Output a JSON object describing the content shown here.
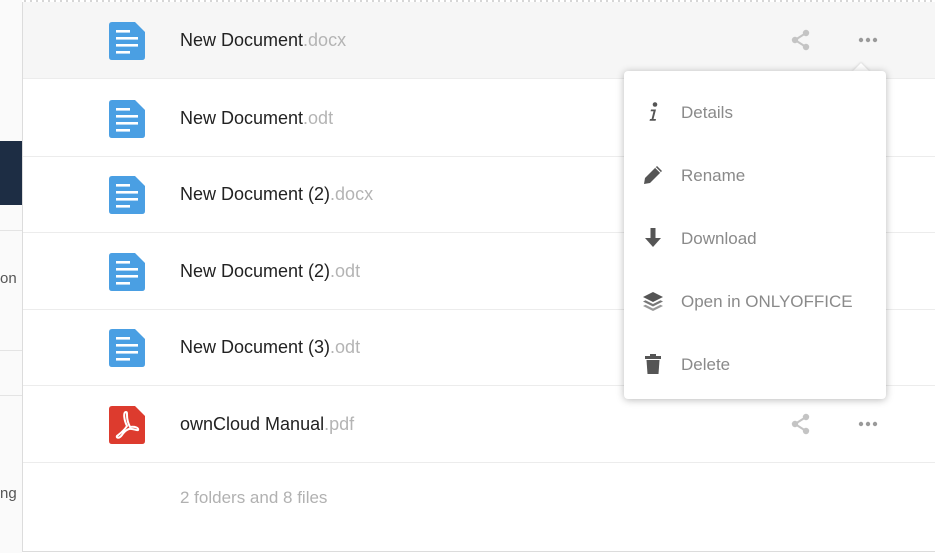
{
  "files": [
    {
      "name": "New Document",
      "ext": ".docx",
      "type": "doc"
    },
    {
      "name": "New Document",
      "ext": ".odt",
      "type": "doc"
    },
    {
      "name": "New Document (2)",
      "ext": ".docx",
      "type": "doc"
    },
    {
      "name": "New Document (2)",
      "ext": ".odt",
      "type": "doc"
    },
    {
      "name": "New Document (3)",
      "ext": ".odt",
      "type": "doc"
    },
    {
      "name": "ownCloud Manual",
      "ext": ".pdf",
      "type": "pdf"
    }
  ],
  "summary": "2 folders and 8 files",
  "menu": {
    "items": [
      {
        "label": "Details",
        "icon": "info-icon"
      },
      {
        "label": "Rename",
        "icon": "pencil-icon"
      },
      {
        "label": "Download",
        "icon": "download-arrow-icon"
      },
      {
        "label": "Open in ONLYOFFICE",
        "icon": "layers-icon"
      },
      {
        "label": "Delete",
        "icon": "trash-icon"
      }
    ]
  },
  "background": {
    "fragment_1": "on",
    "fragment_2": "ng"
  },
  "colors": {
    "doc_icon": "#4a9fe3",
    "pdf_icon": "#dd3b2e",
    "sidebar_dark": "#1d2d44",
    "extension_text": "#b4b4b4"
  }
}
